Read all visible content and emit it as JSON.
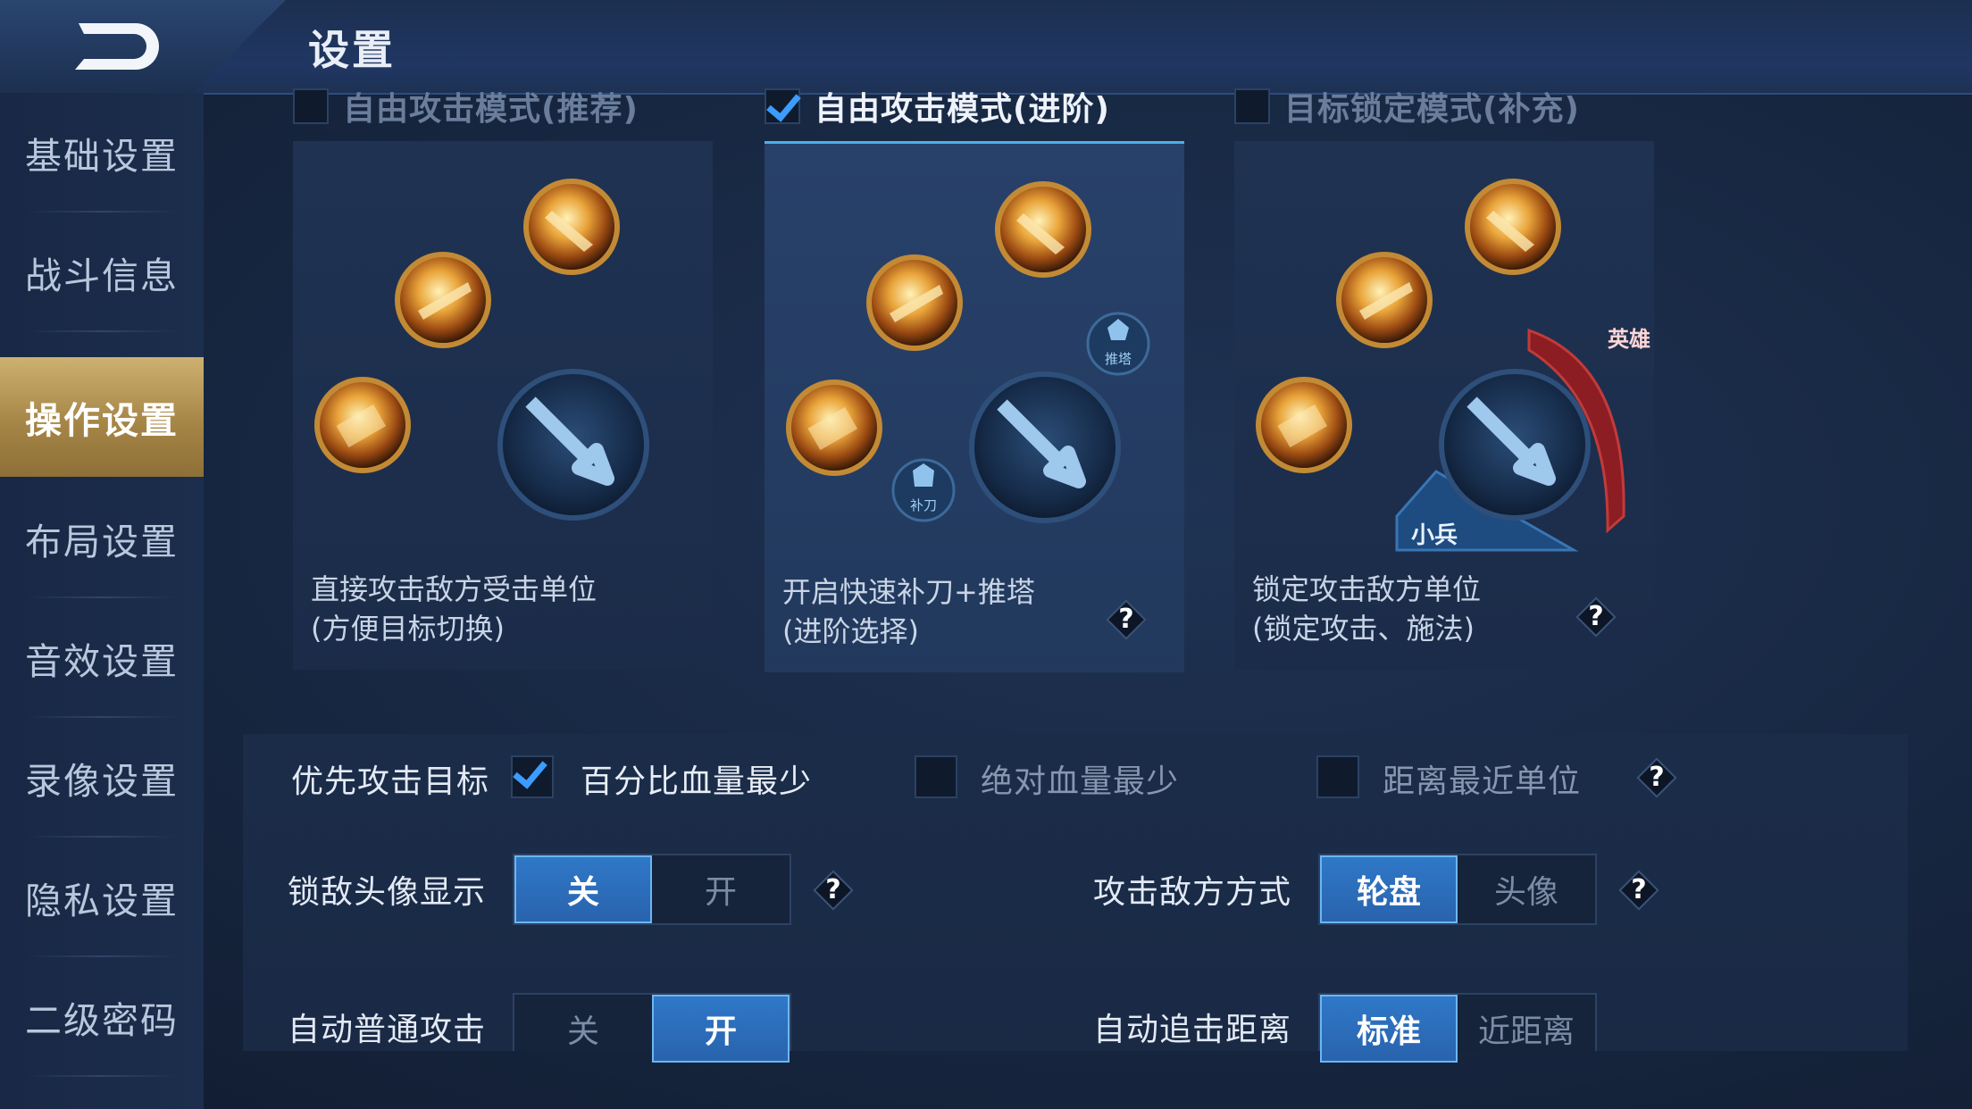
{
  "header": {
    "title": "设置"
  },
  "sidebar": {
    "items": [
      {
        "label": "基础设置",
        "active": false
      },
      {
        "label": "战斗信息",
        "active": false
      },
      {
        "label": "操作设置",
        "active": true
      },
      {
        "label": "布局设置",
        "active": false
      },
      {
        "label": "音效设置",
        "active": false
      },
      {
        "label": "录像设置",
        "active": false
      },
      {
        "label": "隐私设置",
        "active": false
      },
      {
        "label": "二级密码",
        "active": false
      }
    ]
  },
  "modes": [
    {
      "label": "自由攻击模式(推荐)",
      "checked": false,
      "desc_line1": "直接攻击敌方受击单位",
      "desc_line2": "(方便目标切换)"
    },
    {
      "label": "自由攻击模式(进阶)",
      "checked": true,
      "desc_line1": "开启快速补刀+推塔",
      "desc_line2": "(进阶选择)",
      "badges": [
        "推塔",
        "补刀"
      ]
    },
    {
      "label": "目标锁定模式(补充)",
      "checked": false,
      "desc_line1": "锁定攻击敌方单位",
      "desc_line2": "(锁定攻击、施法)",
      "badges": [
        "英雄",
        "小兵"
      ]
    }
  ],
  "priority_target": {
    "label": "优先攻击目标",
    "options": [
      {
        "label": "百分比血量最少",
        "checked": true
      },
      {
        "label": "绝对血量最少",
        "checked": false
      },
      {
        "label": "距离最近单位",
        "checked": false
      }
    ]
  },
  "lock_avatar": {
    "label": "锁敌头像显示",
    "options": [
      "关",
      "开"
    ],
    "selected": "关"
  },
  "attack_method": {
    "label": "攻击敌方方式",
    "options": [
      "轮盘",
      "头像"
    ],
    "selected": "轮盘"
  },
  "auto_attack": {
    "label": "自动普通攻击",
    "options": [
      "关",
      "开"
    ],
    "selected": "开"
  },
  "chase_distance": {
    "label": "自动追击距离",
    "options": [
      "标准",
      "近距离"
    ],
    "selected": "标准"
  },
  "help_glyph": "?",
  "colors": {
    "accent_blue": "#3c9cff",
    "active_gold": "#b8975a",
    "background": "#16233b"
  }
}
